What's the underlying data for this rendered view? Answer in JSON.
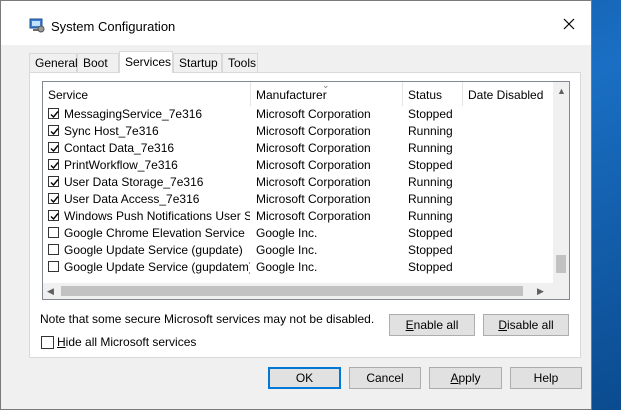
{
  "window": {
    "title": "System Configuration"
  },
  "tabs": [
    {
      "label": "General",
      "active": false
    },
    {
      "label": "Boot",
      "active": false
    },
    {
      "label": "Services",
      "active": true
    },
    {
      "label": "Startup",
      "active": false
    },
    {
      "label": "Tools",
      "active": false
    }
  ],
  "table": {
    "columns": {
      "service": "Service",
      "manufacturer": "Manufacturer",
      "status": "Status",
      "date_disabled": "Date Disabled"
    },
    "rows": [
      {
        "service": "MessagingService_7e316",
        "manufacturer": "Microsoft Corporation",
        "status": "Stopped",
        "checked": true
      },
      {
        "service": "Sync Host_7e316",
        "manufacturer": "Microsoft Corporation",
        "status": "Running",
        "checked": true
      },
      {
        "service": "Contact Data_7e316",
        "manufacturer": "Microsoft Corporation",
        "status": "Running",
        "checked": true
      },
      {
        "service": "PrintWorkflow_7e316",
        "manufacturer": "Microsoft Corporation",
        "status": "Stopped",
        "checked": true
      },
      {
        "service": "User Data Storage_7e316",
        "manufacturer": "Microsoft Corporation",
        "status": "Running",
        "checked": true
      },
      {
        "service": "User Data Access_7e316",
        "manufacturer": "Microsoft Corporation",
        "status": "Running",
        "checked": true
      },
      {
        "service": "Windows Push Notifications User Se...",
        "manufacturer": "Microsoft Corporation",
        "status": "Running",
        "checked": true
      },
      {
        "service": "Google Chrome Elevation Service",
        "manufacturer": "Google Inc.",
        "status": "Stopped",
        "checked": false
      },
      {
        "service": "Google Update Service (gupdate)",
        "manufacturer": "Google Inc.",
        "status": "Stopped",
        "checked": false
      },
      {
        "service": "Google Update Service (gupdatem)",
        "manufacturer": "Google Inc.",
        "status": "Stopped",
        "checked": false
      }
    ]
  },
  "note": "Note that some secure Microsoft services may not be disabled.",
  "buttons": {
    "enable_all": {
      "accel": "E",
      "rest": "nable all"
    },
    "disable_all": {
      "accel": "D",
      "rest": "isable all"
    },
    "ok": "OK",
    "cancel": "Cancel",
    "apply": {
      "accel": "A",
      "rest": "pply"
    },
    "help": "Help"
  },
  "hide_ms": {
    "accel": "H",
    "rest": "ide all Microsoft services",
    "checked": false
  },
  "colors": {
    "accent": "#0078d7",
    "desktop": "#1565b4"
  },
  "icons": {
    "app": "system-config-icon",
    "close": "close-icon"
  }
}
